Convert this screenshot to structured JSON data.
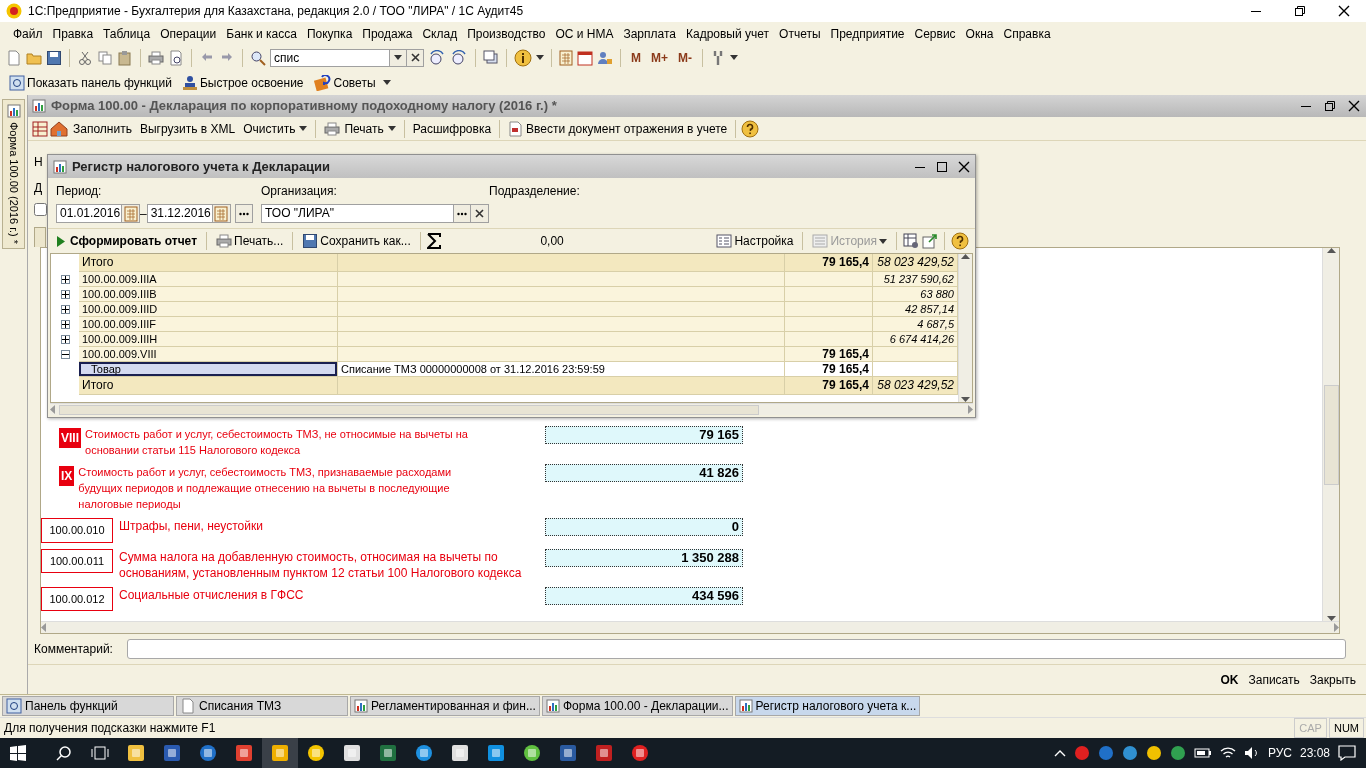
{
  "window": {
    "title": "1С:Предприятие - Бухгалтерия для Казахстана, редакция 2.0 / ТОО \"ЛИРА\" / 1С Аудит45"
  },
  "menu": [
    "Файл",
    "Правка",
    "Таблица",
    "Операции",
    "Банк и касса",
    "Покупка",
    "Продажа",
    "Склад",
    "Производство",
    "ОС и НМА",
    "Зарплата",
    "Кадровый учет",
    "Отчеты",
    "Предприятие",
    "Сервис",
    "Окна",
    "Справка"
  ],
  "toolbar": {
    "search_value": "спис",
    "memory_buttons": [
      "M",
      "M+",
      "M-"
    ]
  },
  "function_bar": [
    "Показать панель функций",
    "Быстрое освоение",
    "Советы"
  ],
  "side_tab": {
    "label": "Форма 100.00 (2016 г.) *"
  },
  "form": {
    "title": "Форма 100.00 - Декларация по корпоративному подоходному налогу (2016 г.) *",
    "toolbar": [
      {
        "label": "Заполнить",
        "dropdown": false
      },
      {
        "label": "Выгрузить в XML",
        "dropdown": false
      },
      {
        "label": "Очистить",
        "dropdown": true
      },
      {
        "label": "Печать",
        "dropdown": true
      },
      {
        "label": "Расшифровка",
        "dropdown": false
      },
      {
        "label": "Ввести документ отражения в учете",
        "dropdown": false
      }
    ],
    "hidden_labels": [
      "Н",
      "Д"
    ],
    "checkbox": {
      "checked": false
    },
    "lines": [
      {
        "kind": "roman",
        "code": "VIII",
        "text": "Стоимость работ и услуг, себестоимость ТМЗ, не относимые на вычеты на основании статьи 115 Налогового кодекса",
        "value": "79 165"
      },
      {
        "kind": "roman",
        "code": "IX",
        "text": "Стоимость работ и услуг, себестоимость ТМЗ, признаваемые расходами будущих периодов и подлежащие отнесению на вычеты в последующие налоговые периоды",
        "value": "41 826"
      },
      {
        "kind": "code",
        "code": "100.00.010",
        "text": "Штрафы, пени, неустойки",
        "value": "0"
      },
      {
        "kind": "code",
        "code": "100.00.011",
        "text": "Сумма налога на добавленную стоимость, относимая на вычеты по основаниям, установленным пунктом 12 статьи 100 Налогового кодекса",
        "value": "1 350 288"
      },
      {
        "kind": "code",
        "code": "100.00.012",
        "text": "Социальные отчисления в ГФСС",
        "value": "434 596"
      }
    ],
    "comment_label": "Комментарий:",
    "buttons": [
      {
        "label": "OK",
        "default": true
      },
      {
        "label": "Записать",
        "default": false
      },
      {
        "label": "Закрыть",
        "default": false
      }
    ]
  },
  "register": {
    "title": "Регистр налогового учета к Декларации",
    "period_label": "Период:",
    "date_from": "01.01.2016",
    "date_to": "31.12.2016",
    "dash": "–",
    "org_label": "Организация:",
    "org_value": "ТОО \"ЛИРА\"",
    "division_label": "Подразделение:",
    "tools": [
      {
        "kind": "generate",
        "label": "Сформировать отчет",
        "disabled": false
      },
      {
        "kind": "print",
        "label": "Печать...",
        "disabled": false
      },
      {
        "kind": "save",
        "label": "Сохранить как...",
        "disabled": false
      },
      {
        "kind": "sum",
        "label": "0,00",
        "disabled": false
      },
      {
        "kind": "settings",
        "label": "Настройка",
        "disabled": false
      },
      {
        "kind": "history",
        "label": "История",
        "disabled": true
      }
    ],
    "rows": [
      {
        "kind": "total",
        "name": "Итого",
        "amount": "79 165,4",
        "extra": "58 023 429,52",
        "selected": false
      },
      {
        "kind": "group",
        "expanded": false,
        "name": "100.00.009.IIIA",
        "extra": "51 237 590,62",
        "selected": false
      },
      {
        "kind": "group",
        "expanded": false,
        "name": "100.00.009.IIIB",
        "extra": "63 880",
        "selected": false
      },
      {
        "kind": "group",
        "expanded": false,
        "name": "100.00.009.IIID",
        "extra": "42 857,14",
        "selected": false
      },
      {
        "kind": "group",
        "expanded": false,
        "name": "100.00.009.IIIF",
        "extra": "4 687,5",
        "selected": false
      },
      {
        "kind": "group",
        "expanded": false,
        "name": "100.00.009.IIIH",
        "extra": "6 674 414,26",
        "selected": false
      },
      {
        "kind": "group",
        "expanded": true,
        "name": "100.00.009.VIII",
        "amount": "79 165,4",
        "selected": false
      },
      {
        "kind": "detail",
        "name": "Товар",
        "document": "Списание ТМЗ 00000000008 от 31.12.2016 23:59:59",
        "amount": "79 165,4",
        "selected": true
      },
      {
        "kind": "total",
        "name": "Итого",
        "amount": "79 165,4",
        "extra": "58 023 429,52",
        "selected": false
      }
    ]
  },
  "tasks": [
    {
      "label": "Панель функций",
      "selected": false
    },
    {
      "label": "Списания ТМЗ",
      "selected": false
    },
    {
      "label": "Регламентированная и фин...",
      "selected": false
    },
    {
      "label": "Форма 100.00 - Декларации...",
      "selected": false
    },
    {
      "label": "Регистр налогового учета к...",
      "selected": true
    }
  ],
  "status_bar": {
    "hint": "Для получения подсказки нажмите F1",
    "indicators": [
      {
        "label": "CAP",
        "on": false
      },
      {
        "label": "NUM",
        "on": true
      }
    ]
  },
  "taskbar": {
    "language": "РУС",
    "time": "23:08"
  }
}
